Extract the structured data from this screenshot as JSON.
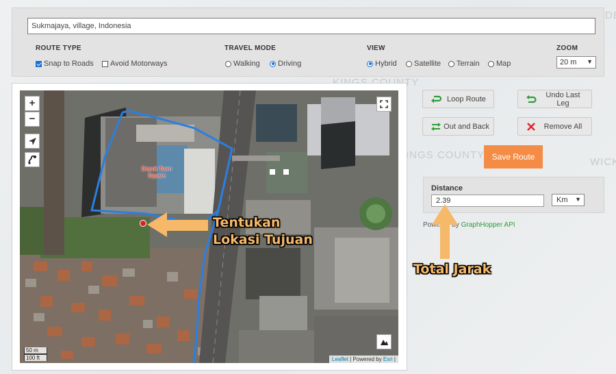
{
  "background_labels": [
    "KINGS COUNTY",
    "KINGS COUNTY",
    "WICK",
    "DE"
  ],
  "address": {
    "value": "Sukmajaya, village, Indonesia"
  },
  "route_type": {
    "title": "ROUTE TYPE",
    "snap_to_roads": {
      "label": "Snap to Roads",
      "checked": true
    },
    "avoid_motorways": {
      "label": "Avoid Motorways",
      "checked": false
    }
  },
  "travel_mode": {
    "title": "TRAVEL MODE",
    "options": [
      {
        "label": "Walking",
        "selected": false
      },
      {
        "label": "Driving",
        "selected": true
      }
    ]
  },
  "view": {
    "title": "VIEW",
    "options": [
      {
        "label": "Hybrid",
        "selected": true
      },
      {
        "label": "Satellite",
        "selected": false
      },
      {
        "label": "Terrain",
        "selected": false
      },
      {
        "label": "Map",
        "selected": false
      }
    ]
  },
  "zoom": {
    "title": "ZOOM",
    "value": "20 m"
  },
  "map": {
    "zoom_in": "+",
    "zoom_out": "−",
    "poi_label": "Depok Town Square",
    "scale_top": "50 m",
    "scale_bottom": "100 ft",
    "attribution": {
      "leaflet": "Leaflet",
      "sep": " | Powered by ",
      "esri": "Esri",
      "end": " |"
    },
    "route_color": "#2b7fe0",
    "marker_color": "#e11d2a"
  },
  "annotations": {
    "destination": "Tentukan\nLokasi Tujuan",
    "total": "Total Jarak",
    "color": "#f6b869"
  },
  "actions": {
    "loop_route": "Loop Route",
    "undo_last_leg": "Undo Last Leg",
    "out_and_back": "Out and Back",
    "remove_all": "Remove All",
    "save_route": "Save Route"
  },
  "distance": {
    "title": "Distance",
    "value": "2.39",
    "unit": "Km"
  },
  "powered": {
    "prefix": "Powered by ",
    "link": "GraphHopper API"
  },
  "colors": {
    "save": "#f48c46",
    "green_icon": "#2e9b3a",
    "red_icon": "#e0242b"
  }
}
